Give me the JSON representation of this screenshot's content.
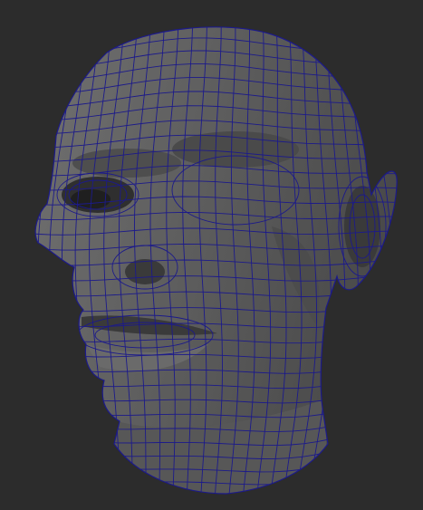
{
  "viewport": {
    "background": "#2c2c2c",
    "mesh_fill": "#5a5a5a",
    "mesh_shadow": "#3c3c3c",
    "mesh_highlight": "#6e6e6e",
    "wire_color": "#1c1a8a"
  },
  "model": {
    "icon": "3d-head-mesh"
  }
}
